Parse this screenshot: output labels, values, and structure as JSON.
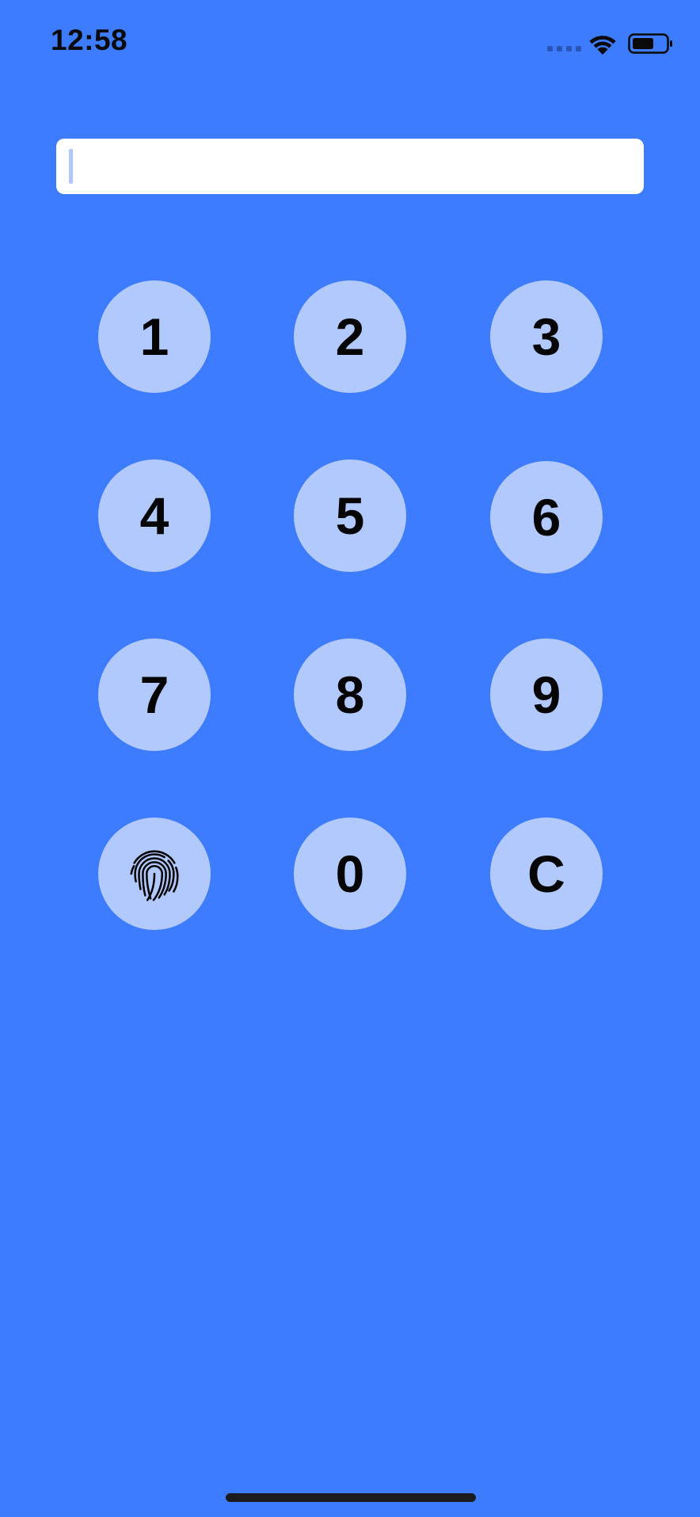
{
  "status_bar": {
    "time": "12:58"
  },
  "pin_field": {
    "value": "",
    "placeholder": ""
  },
  "keypad": {
    "keys": [
      "1",
      "2",
      "3",
      "4",
      "5",
      "6",
      "7",
      "8",
      "9",
      "fingerprint",
      "0",
      "C"
    ],
    "key_1": "1",
    "key_2": "2",
    "key_3": "3",
    "key_4": "4",
    "key_5": "5",
    "key_6": "6",
    "key_7": "7",
    "key_8": "8",
    "key_9": "9",
    "key_0": "0",
    "key_clear": "C",
    "biometric_icon": "fingerprint-icon"
  },
  "colors": {
    "background": "#3d7bff",
    "key_fill": "#b2c9fe",
    "key_text": "#050505",
    "field_fill": "#ffffff",
    "cursor": "#b3c6ff"
  }
}
